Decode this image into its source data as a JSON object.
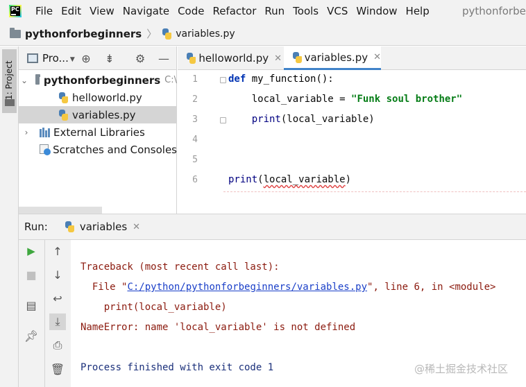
{
  "menubar": {
    "items": [
      "File",
      "Edit",
      "View",
      "Navigate",
      "Code",
      "Refactor",
      "Run",
      "Tools",
      "VCS",
      "Window",
      "Help"
    ],
    "window_title": "pythonforbeg"
  },
  "navbar": {
    "project": "pythonforbeginners",
    "file": "variables.py"
  },
  "left_strip": {
    "label": "1: Project"
  },
  "project_panel": {
    "title": "Pro...",
    "root_name": "pythonforbeginners",
    "root_path": "C:\\",
    "files": [
      "helloworld.py",
      "variables.py"
    ],
    "external_libraries": "External Libraries",
    "scratches": "Scratches and Consoles"
  },
  "editor": {
    "tabs": [
      "helloworld.py",
      "variables.py"
    ],
    "active_tab": "variables.py",
    "line_numbers": [
      "1",
      "2",
      "3",
      "4",
      "5",
      "6"
    ],
    "lines": {
      "l1_kw": "def",
      "l1_rest": " my_function():",
      "l2_var": "    local_variable = ",
      "l2_str": "\"Funk soul brother\"",
      "l3_fn": "    print",
      "l3_rest": "(local_variable)",
      "l6_fn": "print",
      "l6_open": "(",
      "l6_arg": "local_variable",
      "l6_close": ")"
    }
  },
  "run_panel": {
    "label": "Run:",
    "tab": "variables",
    "console": {
      "traceback": "Traceback (most recent call last):",
      "file_prefix": "  File \"",
      "file_link": "C:/python/pythonforbeginners/variables.py",
      "file_suffix": "\", line 6, in <module>",
      "code": "    print(local_variable)",
      "error": "NameError: name 'local_variable' is not defined",
      "exit": "Process finished with exit code 1"
    }
  },
  "watermark": "@稀土掘金技术社区",
  "colors": {
    "keyword": "#0033b3",
    "string": "#067d17",
    "error_text": "#8b1a0e",
    "link": "#1a3fc8",
    "active_tab_underline": "#4083c9",
    "run_green": "#3fa73f"
  }
}
